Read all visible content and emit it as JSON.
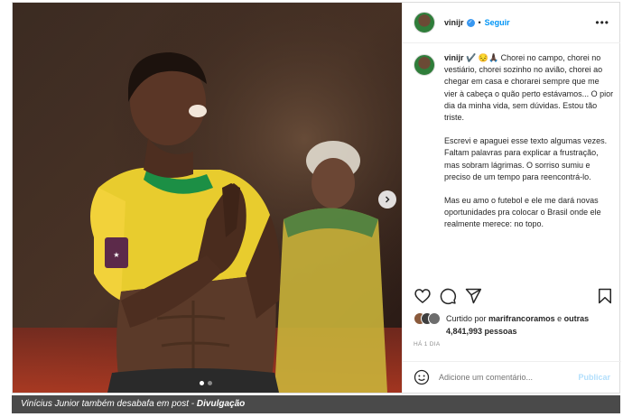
{
  "post": {
    "username": "vinijr",
    "follow_label": "Seguir",
    "separator": "•",
    "more_label": "•••",
    "caption_username": "vinijr",
    "caption_paragraphs": [
      "✔️ 😔🙏🏿 Chorei no campo, chorei no vestiário, chorei sozinho no avião, chorei ao chegar em casa e chorarei sempre que me vier à cabeça o quão perto estávamos... O pior dia da minha vida, sem dúvidas. Estou tão triste.",
      "Escrevi e apaguei esse texto algumas vezes. Faltam palavras para explicar a frustração, mas sobram lágrimas. O sorriso sumiu e preciso de um tempo para reencontrá-lo.",
      "Mas eu amo o futebol e ele me dará novas oportunidades pra colocar o Brasil onde ele realmente merece: no topo."
    ],
    "likes_prefix": "Curtido por",
    "likes_user": "marifrancoramos",
    "likes_connector": "e",
    "likes_others": "outras 4,841,993 pessoas",
    "timestamp": "HÁ 1 DIA",
    "comment_placeholder": "Adicione um comentário...",
    "publish_label": "Publicar",
    "carousel": {
      "current": 1,
      "total": 2
    }
  },
  "icons": [
    "heart-icon",
    "comment-icon",
    "share-icon",
    "bookmark-icon",
    "emoji-icon",
    "verified-icon",
    "chevron-right-icon"
  ],
  "colors": {
    "link": "#0095f6",
    "verified": "#3897f0",
    "publish_disabled": "#b2dffc",
    "brazil_yellow": "#f2d23a",
    "brazil_green": "#1c8f45"
  },
  "caption_bar": {
    "text": "Vinícius Junior também desabafa em post -",
    "credit": "Divulgação"
  }
}
